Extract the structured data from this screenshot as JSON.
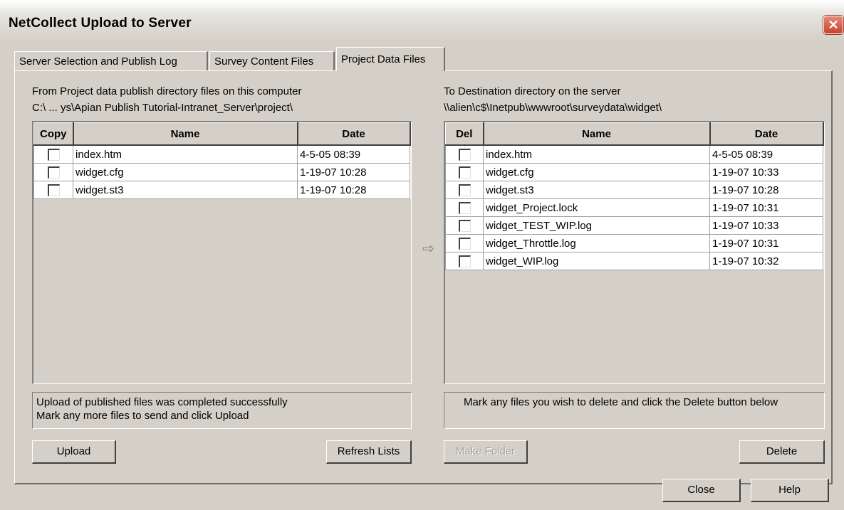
{
  "window": {
    "title": "NetCollect Upload to Server",
    "close_glyph": "✕"
  },
  "tabs": [
    {
      "label": "Server Selection and Publish Log",
      "active": false
    },
    {
      "label": "Survey Content Files",
      "active": false
    },
    {
      "label": "Project Data Files",
      "active": true
    }
  ],
  "source": {
    "heading": "From Project data publish directory files on this computer",
    "path": "C:\\ ... ys\\Apian Publish Tutorial-Intranet_Server\\project\\",
    "columns": [
      "Copy",
      "Name",
      "Date"
    ],
    "files": [
      {
        "name": "index.htm",
        "date": "4-5-05 08:39"
      },
      {
        "name": "widget.cfg",
        "date": "1-19-07 10:28"
      },
      {
        "name": "widget.st3",
        "date": "1-19-07 10:28"
      }
    ],
    "status_line1": "Upload of published files was completed successfully",
    "status_line2": "Mark any more files to send and click Upload"
  },
  "destination": {
    "heading": "To Destination directory on the server",
    "path": "\\\\alien\\c$\\Inetpub\\wwwroot\\surveydata\\widget\\",
    "columns": [
      "Del",
      "Name",
      "Date"
    ],
    "files": [
      {
        "name": "index.htm",
        "date": "4-5-05 08:39"
      },
      {
        "name": "widget.cfg",
        "date": "1-19-07 10:33"
      },
      {
        "name": "widget.st3",
        "date": "1-19-07 10:28"
      },
      {
        "name": "widget_Project.lock",
        "date": "1-19-07 10:31"
      },
      {
        "name": "widget_TEST_WIP.log",
        "date": "1-19-07 10:33"
      },
      {
        "name": "widget_Throttle.log",
        "date": "1-19-07 10:31"
      },
      {
        "name": "widget_WIP.log",
        "date": "1-19-07 10:32"
      }
    ],
    "status": "Mark any files you wish to delete and click the Delete button below"
  },
  "buttons": {
    "upload": "Upload",
    "refresh": "Refresh Lists",
    "make_folder": "Make Folder",
    "delete": "Delete",
    "close": "Close",
    "help": "Help"
  },
  "icons": {
    "transfer_arrow": "arrow-right-icon",
    "close": "close-icon"
  }
}
